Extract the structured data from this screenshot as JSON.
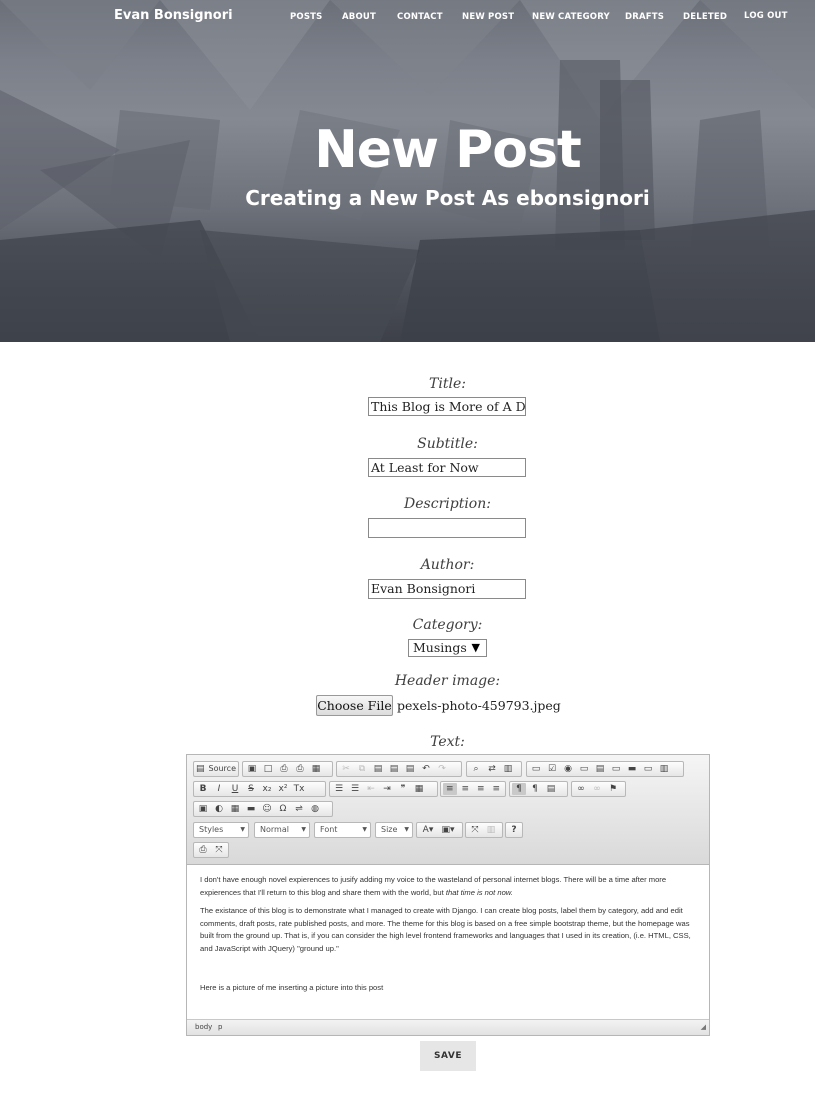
{
  "header": {
    "brand": "Evan Bonsignori",
    "nav": [
      "POSTS",
      "ABOUT",
      "CONTACT",
      "NEW POST",
      "NEW CATEGORY",
      "DRAFTS",
      "DELETED",
      "LOG OUT"
    ],
    "title": "New Post",
    "subtitle": "Creating a New Post As ebonsignori"
  },
  "form": {
    "title_label": "Title:",
    "title_value": "This Blog is More of A Demo",
    "subtitle_label": "Subtitle:",
    "subtitle_value": "At Least for Now",
    "description_label": "Description:",
    "description_value": "",
    "author_label": "Author:",
    "author_value": "Evan Bonsignori",
    "category_label": "Category:",
    "category_value": "Musings",
    "header_image_label": "Header image:",
    "choose_file_label": "Choose File",
    "file_name": "pexels-photo-459793.jpeg",
    "text_label": "Text:",
    "save_label": "SAVE"
  },
  "editor": {
    "source_label": "Source",
    "styles_label": "Styles",
    "format_label": "Normal",
    "font_label": "Font",
    "size_label": "Size",
    "help_label": "?",
    "paragraph1_a": "I don't have enough novel expierences to jusify adding my voice to the wasteland of personal internet blogs. There will be a time after more expierences that I'll return to this blog and share them with the world, but ",
    "paragraph1_b": "that time is not now.",
    "paragraph2": "The existance of this blog is to demonstrate what I managed to create with Django. I can create blog posts, label them by category, add and edit comments, draft posts, rate published posts, and more. The theme for this blog is based on a free simple bootstrap theme, but the homepage was built from the ground up. That is, if you can consider the high level frontend frameworks and languages that I used in its creation, (i.e. HTML, CSS, and JavaScript with JQuery) \"ground up.\"",
    "paragraph3": "Here is a picture of me inserting a picture into this post",
    "status_body": "body",
    "status_p": "p"
  }
}
